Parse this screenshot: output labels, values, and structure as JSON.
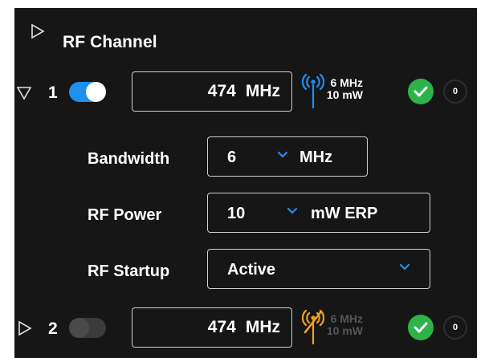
{
  "section": {
    "title": "RF Channel"
  },
  "channels": [
    {
      "number": "1",
      "enabled": true,
      "frequency_value": "474",
      "frequency_unit": "MHz",
      "bandwidth_text": "6 MHz",
      "power_text": "10 mW",
      "status": "ok",
      "count": "0"
    },
    {
      "number": "2",
      "enabled": false,
      "frequency_value": "474",
      "frequency_unit": "MHz",
      "bandwidth_text": "6 MHz",
      "power_text": "10 mW",
      "status": "ok",
      "count": "0"
    }
  ],
  "settings": {
    "bandwidth": {
      "label": "Bandwidth",
      "value": "6",
      "unit": "MHz"
    },
    "rf_power": {
      "label": "RF Power",
      "value": "10",
      "unit": "mW ERP"
    },
    "rf_startup": {
      "label": "RF Startup",
      "value": "Active"
    }
  },
  "colors": {
    "toggle_on": "#1f8ef1",
    "antenna_active": "#1f8ef1",
    "antenna_muted": "#f0a020",
    "status_ok": "#2db34a",
    "panel_bg": "#161616"
  },
  "icons": {
    "section_expand": "triangle-right-outline",
    "row_expanded": "triangle-down-outline",
    "row_collapsed": "triangle-right-outline",
    "antenna_active": "antenna-broadcast-icon",
    "antenna_muted": "antenna-muted-icon",
    "status": "check-circle-icon"
  }
}
